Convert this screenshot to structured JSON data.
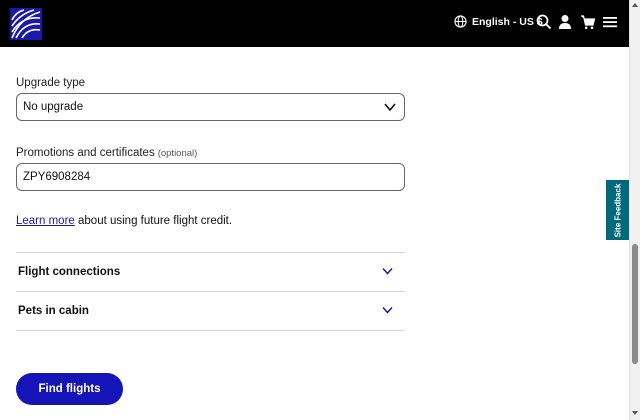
{
  "header": {
    "language_label": "English - US $",
    "icons": [
      "globe-icon",
      "search-icon",
      "user-icon",
      "cart-icon",
      "menu-icon"
    ]
  },
  "form": {
    "upgrade": {
      "label": "Upgrade type",
      "value": "No upgrade"
    },
    "promotions": {
      "label": "Promotions and certificates",
      "optional": "(optional)",
      "value": "ZPY6908284"
    },
    "credit_note": {
      "link_text": "Learn more",
      "text": " about using future flight credit."
    },
    "accordions": [
      {
        "label": "Flight connections"
      },
      {
        "label": "Pets in cabin"
      }
    ],
    "submit_label": "Find flights"
  },
  "feedback_tab": {
    "label": "Site Feedback"
  },
  "colors": {
    "brand_blue": "#1414b8",
    "header_bg": "#000000",
    "feedback_bg": "#006a7a",
    "link": "#1a1aa8"
  }
}
